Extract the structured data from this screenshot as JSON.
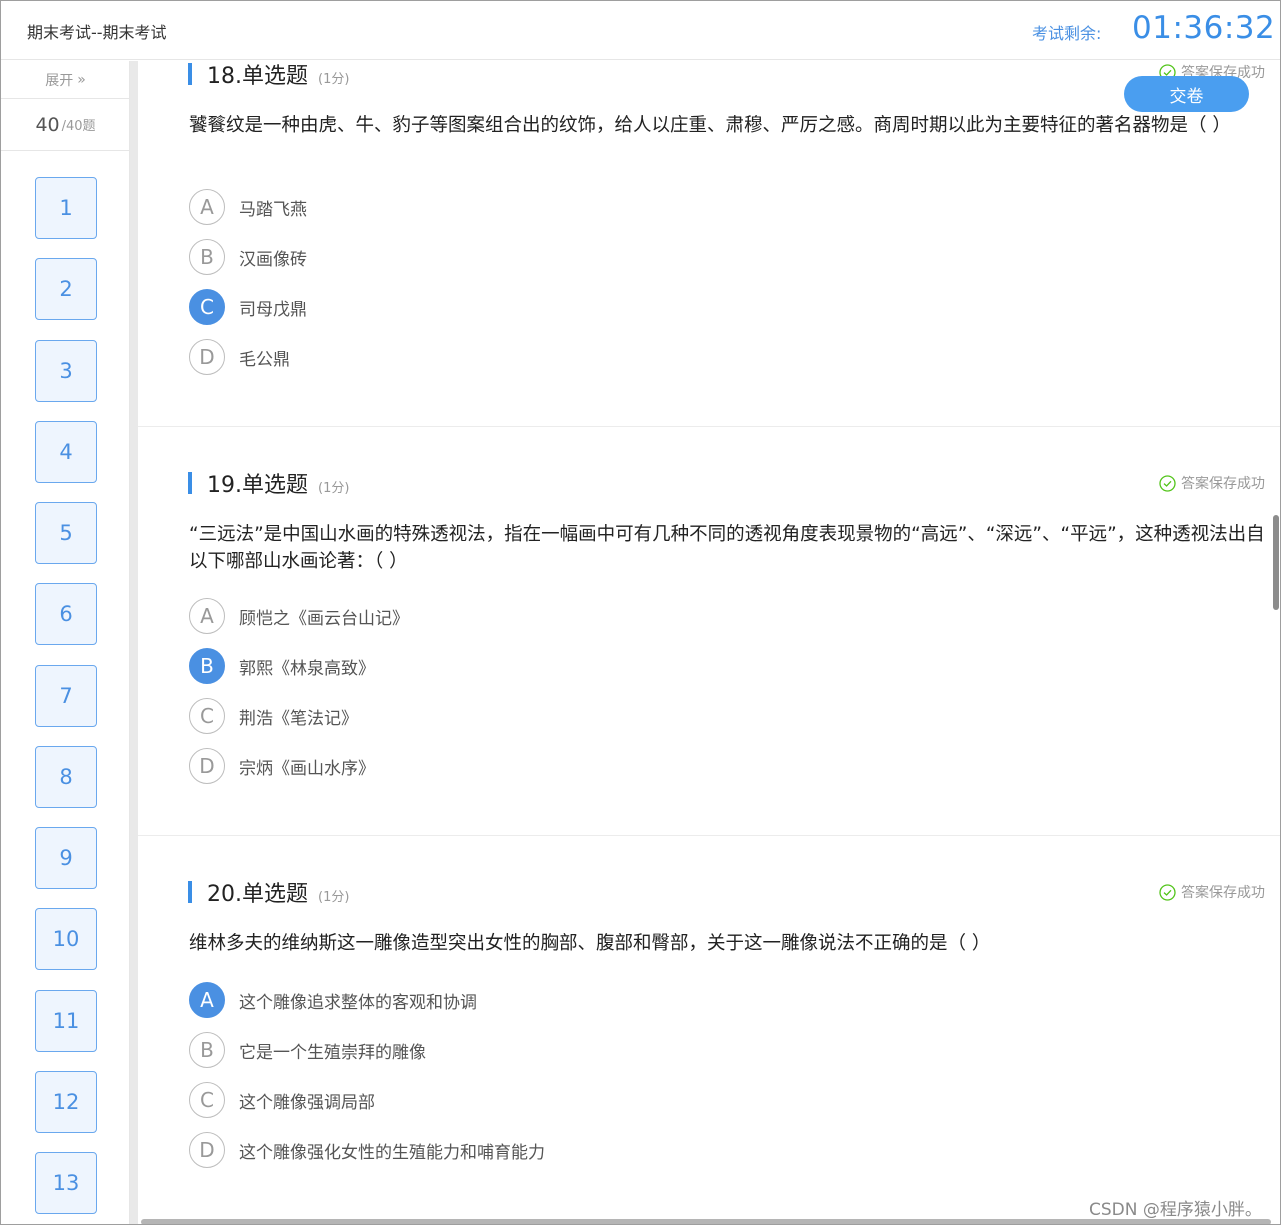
{
  "header": {
    "exam_title": "期末考试--期末考试",
    "timer_label": "考试剩余:",
    "timer_value": "01:36:32"
  },
  "sidebar": {
    "expand_label": "展开",
    "answered_count": "40",
    "total_label": "/40题",
    "question_numbers": [
      "1",
      "2",
      "3",
      "4",
      "5",
      "6",
      "7",
      "8",
      "9",
      "10",
      "11",
      "12",
      "13"
    ]
  },
  "submit_label": "交卷",
  "questions": [
    {
      "title": "18.单选题",
      "score": "(1分)",
      "saved": "答案保存成功",
      "stem": "饕餮纹是一种由虎、牛、豹子等图案组合出的纹饰，给人以庄重、肃穆、严厉之感。商周时期以此为主要特征的著名器物是（ ）",
      "options": [
        {
          "letter": "A",
          "text": "马踏飞燕",
          "selected": false
        },
        {
          "letter": "B",
          "text": "汉画像砖",
          "selected": false
        },
        {
          "letter": "C",
          "text": "司母戊鼎",
          "selected": true
        },
        {
          "letter": "D",
          "text": "毛公鼎",
          "selected": false
        }
      ]
    },
    {
      "title": "19.单选题",
      "score": "(1分)",
      "saved": "答案保存成功",
      "stem": "“三远法”是中国山水画的特殊透视法，指在一幅画中可有几种不同的透视角度表现景物的“高远”、“深远”、“平远”，这种透视法出自以下哪部山水画论著：（ ）",
      "options": [
        {
          "letter": "A",
          "text": "顾恺之《画云台山记》",
          "selected": false
        },
        {
          "letter": "B",
          "text": "郭熙《林泉高致》",
          "selected": true
        },
        {
          "letter": "C",
          "text": "荆浩《笔法记》",
          "selected": false
        },
        {
          "letter": "D",
          "text": "宗炳《画山水序》",
          "selected": false
        }
      ]
    },
    {
      "title": "20.单选题",
      "score": "(1分)",
      "saved": "答案保存成功",
      "stem": "维林多夫的维纳斯这一雕像造型突出女性的胸部、腹部和臀部，关于这一雕像说法不正确的是（ ）",
      "options": [
        {
          "letter": "A",
          "text": "这个雕像追求整体的客观和协调",
          "selected": true
        },
        {
          "letter": "B",
          "text": "它是一个生殖崇拜的雕像",
          "selected": false
        },
        {
          "letter": "C",
          "text": "这个雕像强调局部",
          "selected": false
        },
        {
          "letter": "D",
          "text": "这个雕像强化女性的生殖能力和哺育能力",
          "selected": false
        }
      ]
    }
  ],
  "watermark": "CSDN @程序猿小胖。",
  "colors": {
    "accent": "#4a90e2",
    "saved_green": "#52c41a"
  }
}
